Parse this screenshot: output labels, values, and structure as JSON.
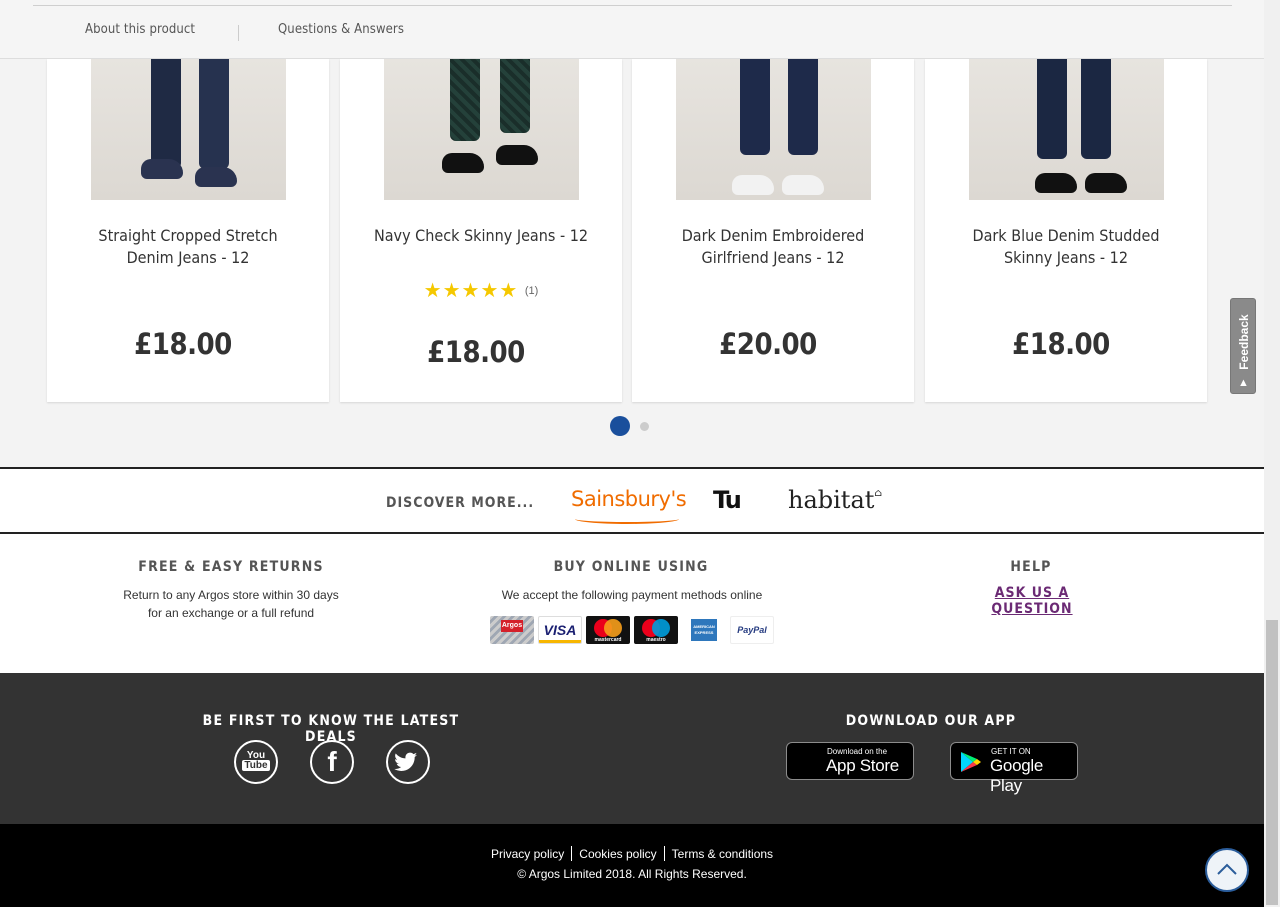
{
  "tabs": {
    "about": "About this product",
    "qa": "Questions & Answers"
  },
  "products": [
    {
      "name": "Straight Cropped Stretch Denim Jeans - 12",
      "price": "£18.00"
    },
    {
      "name": "Navy Check Skinny Jeans - 12",
      "price": "£18.00",
      "rating_stars": "★★★★★",
      "rating_value": 5,
      "review_count": "(1)"
    },
    {
      "name": "Dark Denim Embroidered Girlfriend Jeans - 12",
      "price": "£20.00"
    },
    {
      "name": "Dark Blue Denim Studded Skinny Jeans - 12",
      "price": "£18.00"
    }
  ],
  "carousel": {
    "pages": 2,
    "active_page": 1
  },
  "feedback": {
    "label": "Feedback"
  },
  "discover": {
    "label": "DISCOVER MORE...",
    "brands": [
      "Sainsbury's",
      "Tu",
      "habitat"
    ]
  },
  "returns": {
    "heading": "FREE & EASY RETURNS",
    "line1": "Return to any Argos store within 30 days",
    "line2": "for an exchange or a full refund"
  },
  "payment": {
    "heading": "BUY ONLINE USING",
    "text": "We accept the following payment methods online",
    "methods": [
      {
        "name": "Argos card",
        "icon": "argos-card-icon",
        "label": "Argos"
      },
      {
        "name": "Visa",
        "icon": "visa-icon",
        "label": "VISA"
      },
      {
        "name": "Mastercard",
        "icon": "mastercard-icon",
        "label": "mastercard"
      },
      {
        "name": "Maestro",
        "icon": "maestro-icon",
        "label": "maestro"
      },
      {
        "name": "American Express",
        "icon": "amex-icon",
        "label": "AMERICAN EXPRESS"
      },
      {
        "name": "PayPal",
        "icon": "paypal-icon",
        "label": "PayPal"
      }
    ]
  },
  "help": {
    "heading": "HELP",
    "link": "ASK US A QUESTION"
  },
  "social": {
    "heading": "BE FIRST TO KNOW THE LATEST DEALS",
    "icons": [
      "youtube-icon",
      "facebook-icon",
      "twitter-icon"
    ]
  },
  "app": {
    "heading": "DOWNLOAD OUR APP",
    "appstore_small": "Download on the",
    "appstore_big": "App Store",
    "googleplay_small": "GET IT ON",
    "googleplay_big": "Google Play"
  },
  "legal": {
    "privacy": "Privacy policy",
    "cookies": "Cookies policy",
    "terms": "Terms & conditions",
    "copyright": "© Argos Limited 2018. All Rights Reserved."
  },
  "colors": {
    "accent": "#1a4f9c",
    "help_link": "#6b2a74",
    "star": "#f5c800",
    "dark_band": "#333333",
    "footer": "#000000"
  }
}
